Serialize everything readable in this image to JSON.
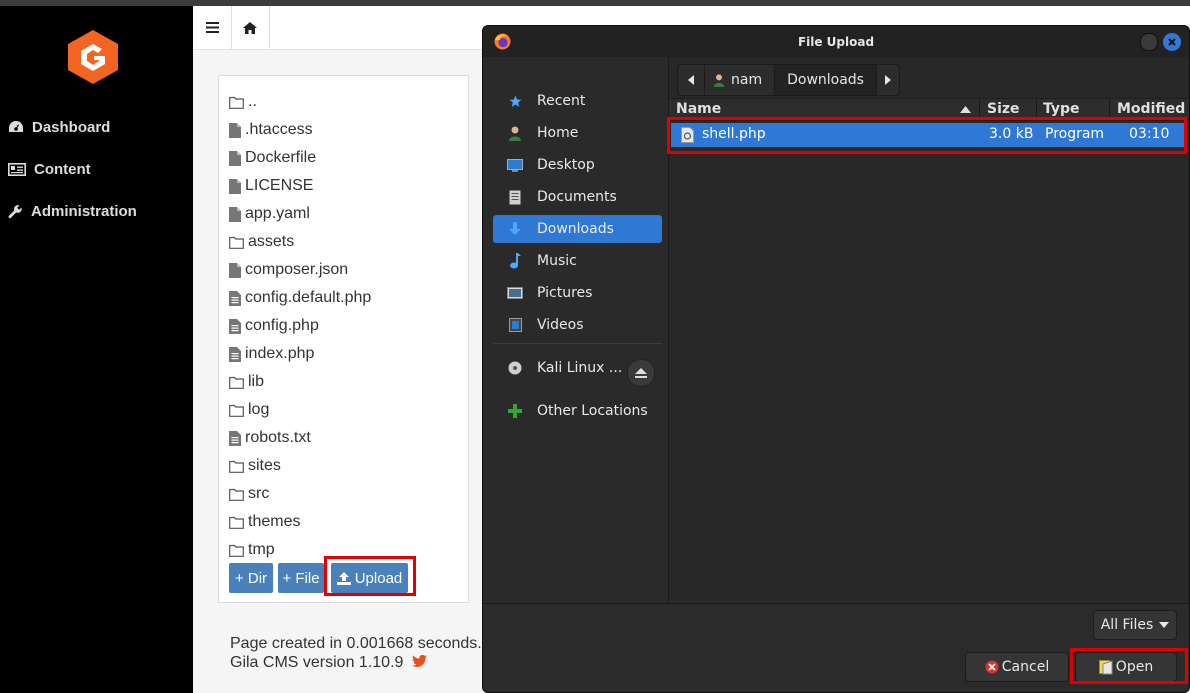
{
  "sidebar": {
    "items": [
      {
        "label": "Dashboard",
        "icon": "dashboard-icon"
      },
      {
        "label": "Content",
        "icon": "content-icon"
      },
      {
        "label": "Administration",
        "icon": "wrench-icon"
      }
    ]
  },
  "topbar": {
    "menu_icon": "hamburger-icon",
    "home_icon": "home-icon"
  },
  "files": {
    "items": [
      {
        "name": "..",
        "type": "folder"
      },
      {
        "name": ".htaccess",
        "type": "file"
      },
      {
        "name": "Dockerfile",
        "type": "file"
      },
      {
        "name": "LICENSE",
        "type": "file"
      },
      {
        "name": "app.yaml",
        "type": "file"
      },
      {
        "name": "assets",
        "type": "folder"
      },
      {
        "name": "composer.json",
        "type": "file"
      },
      {
        "name": "config.default.php",
        "type": "file-text"
      },
      {
        "name": "config.php",
        "type": "file-text"
      },
      {
        "name": "index.php",
        "type": "file-text"
      },
      {
        "name": "lib",
        "type": "folder"
      },
      {
        "name": "log",
        "type": "folder"
      },
      {
        "name": "robots.txt",
        "type": "file-text"
      },
      {
        "name": "sites",
        "type": "folder"
      },
      {
        "name": "src",
        "type": "folder"
      },
      {
        "name": "themes",
        "type": "folder"
      },
      {
        "name": "tmp",
        "type": "folder"
      }
    ],
    "buttons": {
      "dir": "+ Dir",
      "file": "+ File",
      "upload": "Upload"
    }
  },
  "footer": {
    "line1": "Page created in 0.001668 seconds.",
    "line2": "Gila CMS version 1.10.9"
  },
  "dialog": {
    "title": "File Upload",
    "places": [
      {
        "label": "Recent",
        "icon": "recent-star-icon"
      },
      {
        "label": "Home",
        "icon": "home-user-icon"
      },
      {
        "label": "Desktop",
        "icon": "desktop-icon"
      },
      {
        "label": "Documents",
        "icon": "documents-icon"
      },
      {
        "label": "Downloads",
        "icon": "downloads-icon",
        "active": true
      },
      {
        "label": "Music",
        "icon": "music-icon"
      },
      {
        "label": "Pictures",
        "icon": "pictures-icon"
      },
      {
        "label": "Videos",
        "icon": "videos-icon"
      }
    ],
    "devices": [
      {
        "label": "Kali Linux ...",
        "icon": "disc-icon"
      },
      {
        "label": "Other Locations",
        "icon": "plus-icon"
      }
    ],
    "path": {
      "segments": [
        "nam",
        "Downloads"
      ]
    },
    "columns": {
      "name": "Name",
      "size": "Size",
      "type": "Type",
      "modified": "Modified"
    },
    "file": {
      "name": "shell.php",
      "size": "3.0 kB",
      "type": "Program",
      "modified": "03:10"
    },
    "filter": "All Files",
    "buttons": {
      "cancel": "Cancel",
      "open": "Open"
    }
  },
  "colors": {
    "accent": "#2f78d4",
    "upload_button": "#4a81bb",
    "highlight": "#e00000",
    "logo": "#f26522"
  }
}
